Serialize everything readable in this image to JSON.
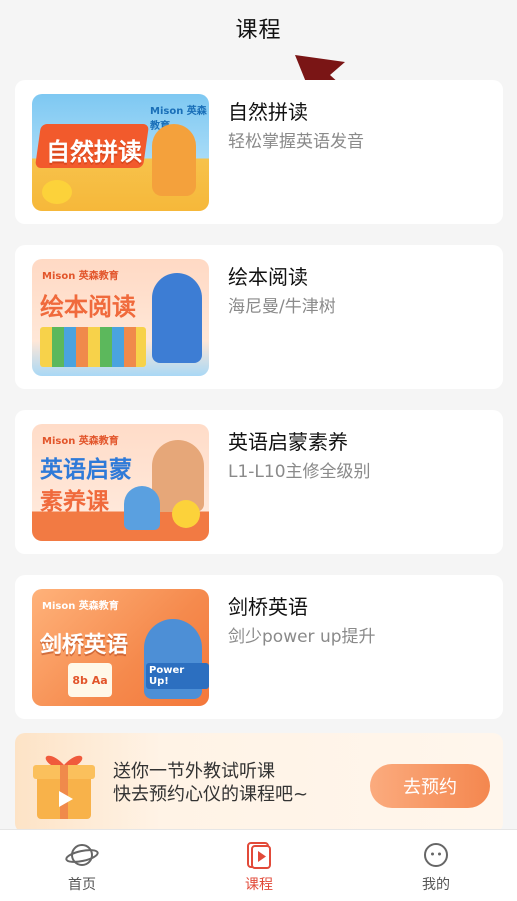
{
  "header": {
    "title": "课程"
  },
  "courses": [
    {
      "title": "自然拼读",
      "subtitle": "轻松掌握英语发音",
      "thumb_text": "自然拼读",
      "brand": "Mison 英森教育"
    },
    {
      "title": "绘本阅读",
      "subtitle": "海尼曼/牛津树",
      "thumb_text": "绘本阅读",
      "brand": "Mison 英森教育"
    },
    {
      "title": "英语启蒙素养",
      "subtitle": "L1-L10主修全级别",
      "thumb_text_1": "英语启蒙",
      "thumb_text_2": "素养课",
      "brand": "Mison 英森教育"
    },
    {
      "title": "剑桥英语",
      "subtitle": "剑少power up提升",
      "thumb_text": "剑桥英语",
      "brand": "Mison 英森教育",
      "badge": "Power Up!"
    }
  ],
  "banner": {
    "line1": "送你一节外教试听课",
    "line2": "快去预约心仪的课程吧~",
    "button": "去预约"
  },
  "tabbar": {
    "home": "首页",
    "courses": "课程",
    "mine": "我的"
  },
  "colors": {
    "accent": "#e24a39",
    "button": "#f4874f"
  }
}
